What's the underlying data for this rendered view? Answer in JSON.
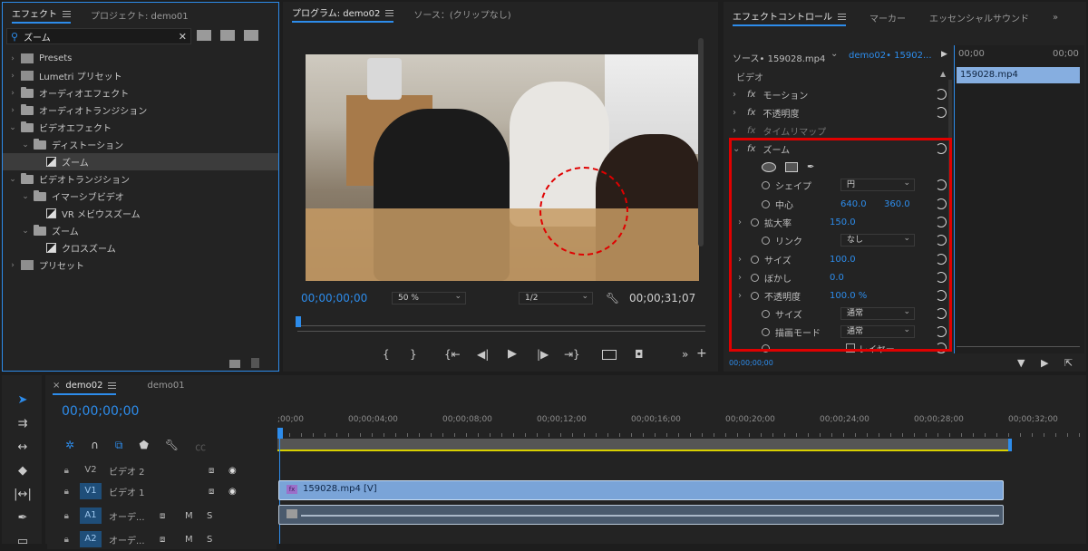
{
  "effects_panel": {
    "tabs": [
      "エフェクト",
      "プロジェクト: demo01"
    ],
    "search_value": "ズーム",
    "tree": [
      {
        "label": "Presets",
        "kind": "preset"
      },
      {
        "label": "Lumetri プリセット",
        "kind": "preset"
      },
      {
        "label": "オーディオエフェクト",
        "kind": "folder"
      },
      {
        "label": "オーディオトランジション",
        "kind": "folder"
      },
      {
        "label": "ビデオエフェクト",
        "kind": "folder-open"
      },
      {
        "label": "ディストーション",
        "kind": "folder-open"
      },
      {
        "label": "ズーム",
        "kind": "effect-selected"
      },
      {
        "label": "ビデオトランジション",
        "kind": "folder-open"
      },
      {
        "label": "イマーシブビデオ",
        "kind": "folder-open"
      },
      {
        "label": "VR メビウスズーム",
        "kind": "effect"
      },
      {
        "label": "ズーム",
        "kind": "folder-open"
      },
      {
        "label": "クロスズーム",
        "kind": "effect"
      },
      {
        "label": "プリセット",
        "kind": "preset"
      }
    ]
  },
  "program_monitor": {
    "tabs": [
      "プログラム: demo02",
      "ソース：(クリップなし)"
    ],
    "timecode_left": "00;00;00;00",
    "zoom": "50 %",
    "resolution": "1/2",
    "timecode_right": "00;00;31;07"
  },
  "effect_controls": {
    "tabs": [
      "エフェクトコントロール",
      "マーカー",
      "エッセンシャルサウンド"
    ],
    "source_label": "ソース• 159028.mp4",
    "sequence_label": "demo02• 15902...",
    "section_video": "ビデオ",
    "mini_ruler": "00;00",
    "clip_label": "159028.mp4",
    "effects": [
      "モーション",
      "不透明度",
      "タイムリマップ",
      "ズーム"
    ],
    "props": {
      "shape": {
        "label": "シェイプ",
        "value": "円"
      },
      "center": {
        "label": "中心",
        "x": "640.0",
        "y": "360.0"
      },
      "scale": {
        "label": "拡大率",
        "value": "150.0"
      },
      "link": {
        "label": "リンク",
        "value": "なし"
      },
      "size": {
        "label": "サイズ",
        "value": "100.0"
      },
      "blur": {
        "label": "ぼかし",
        "value": "0.0"
      },
      "opacity": {
        "label": "不透明度",
        "value": "100.0 %"
      },
      "size2": {
        "label": "サイズ",
        "value": "通常"
      },
      "blend": {
        "label": "描画モード",
        "value": "通常"
      },
      "layer": {
        "label": "レイヤー"
      }
    },
    "bottom_timecode": "00;00;00;00"
  },
  "timeline": {
    "tabs": [
      "demo02",
      "demo01"
    ],
    "timecode": "00;00;00;00",
    "ruler": [
      ";00;00",
      "00;00;04;00",
      "00;00;08;00",
      "00;00;12;00",
      "00;00;16;00",
      "00;00;20;00",
      "00;00;24;00",
      "00;00;28;00",
      "00;00;32;00"
    ],
    "tracks": [
      {
        "id": "V2",
        "name": "ビデオ 2"
      },
      {
        "id": "V1",
        "name": "ビデオ 1"
      },
      {
        "id": "A1",
        "name": "オーデ..."
      },
      {
        "id": "A2",
        "name": "オーデ..."
      }
    ],
    "clip_label": "159028.mp4 [V]",
    "mute": "M",
    "solo": "S"
  },
  "colors": {
    "accent": "#2d8ceb",
    "highlight_box": "#e00000",
    "clip_video": "#6e9bd0"
  }
}
